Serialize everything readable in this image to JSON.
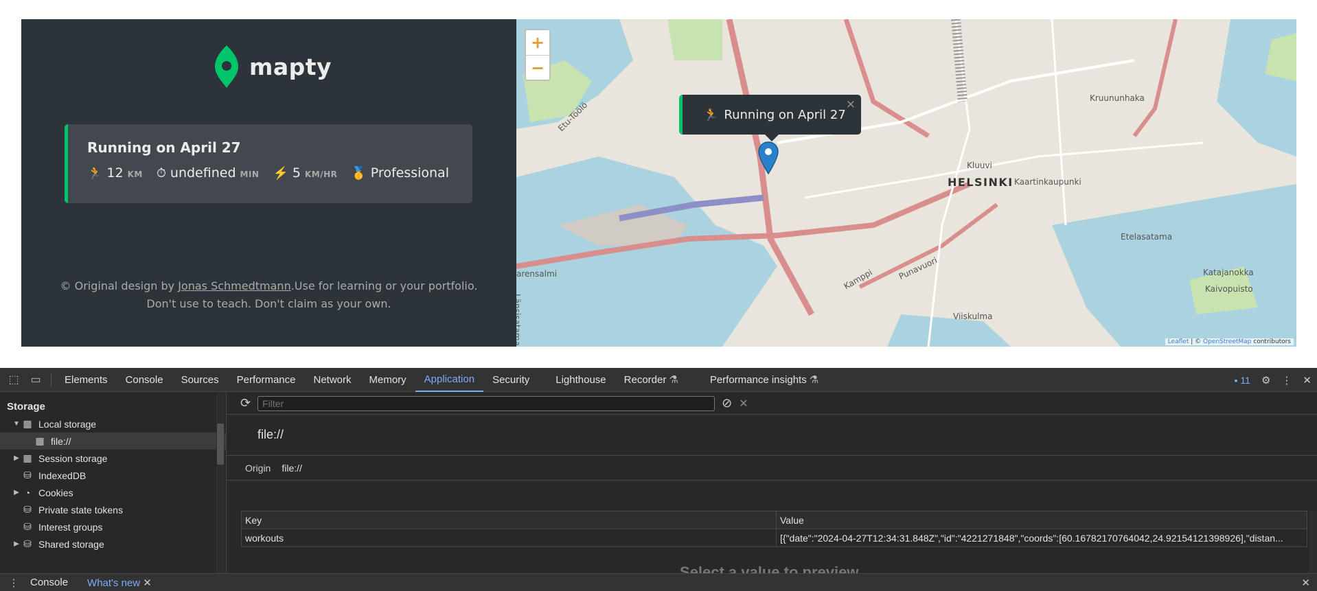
{
  "app": {
    "logo_text": "mapty",
    "workout": {
      "title": "Running on April 27",
      "distance": {
        "icon": "🏃",
        "value": "12",
        "unit": "KM"
      },
      "duration": {
        "icon": "⏱",
        "value": "undefined",
        "unit": "MIN"
      },
      "pace": {
        "icon": "⚡️",
        "value": "5",
        "unit": "KM/HR"
      },
      "level": {
        "icon": "🥇",
        "value": "Professional"
      }
    },
    "copyright": {
      "prefix": "© Original design by ",
      "author": "Jonas Schmedtmann",
      "suffix": ".Use for learning or your portfolio.",
      "line2": "Don't use to teach. Don't claim as your own."
    }
  },
  "map": {
    "zoom_in": "+",
    "zoom_out": "−",
    "popup": {
      "icon": "🏃",
      "text": "Running on April 27",
      "close": "×"
    },
    "labels": {
      "helsinki": "HELSINKI",
      "kluuvi": "Kluuvi",
      "kaartinkaupunki": "Kaartinkaupunki",
      "kruununhaka": "Kruununhaka",
      "etelasatama": "Etelasatama",
      "katajanokka": "Katajanokka",
      "kaivopuisto": "Kaivopuisto",
      "viiskulma": "Viiskulma",
      "punavuori": "Punavuori",
      "kamppi": "Kamppi",
      "arensalmi": "arensalmi",
      "lansisatama": "Länsisatama",
      "etu_toolo": "Etu-Töölö"
    },
    "attribution": {
      "leaflet": "Leaflet",
      "sep": " | © ",
      "osm": "OpenStreetMap",
      "suffix": " contributors"
    },
    "accent_color": "#00c46a",
    "pin_color": "#2a81cb"
  },
  "devtools": {
    "tabs": [
      "Elements",
      "Console",
      "Sources",
      "Performance",
      "Network",
      "Memory",
      "Application",
      "Security",
      "Lighthouse",
      "Recorder",
      "Performance insights"
    ],
    "active_tab": "Application",
    "issues_badge": "11",
    "tree": {
      "heading": "Storage",
      "items": {
        "local_storage": "Local storage",
        "file": "file://",
        "session_storage": "Session storage",
        "indexeddb": "IndexedDB",
        "cookies": "Cookies",
        "private_state_tokens": "Private state tokens",
        "interest_groups": "Interest groups",
        "shared_storage": "Shared storage"
      }
    },
    "filter_placeholder": "Filter",
    "origin_title": "file://",
    "origin_label": "Origin",
    "origin_value": "file://",
    "table": {
      "headers": [
        "Key",
        "Value"
      ],
      "rows": [
        {
          "key": "workouts",
          "value": "[{\"date\":\"2024-04-27T12:34:31.848Z\",\"id\":\"4221271848\",\"coords\":[60.16782170764042,24.92154121398926],\"distan..."
        }
      ]
    },
    "bottom_message": "Select a value to preview",
    "drawer": {
      "tabs": [
        "Console",
        "What's new"
      ],
      "active": "What's new"
    }
  }
}
